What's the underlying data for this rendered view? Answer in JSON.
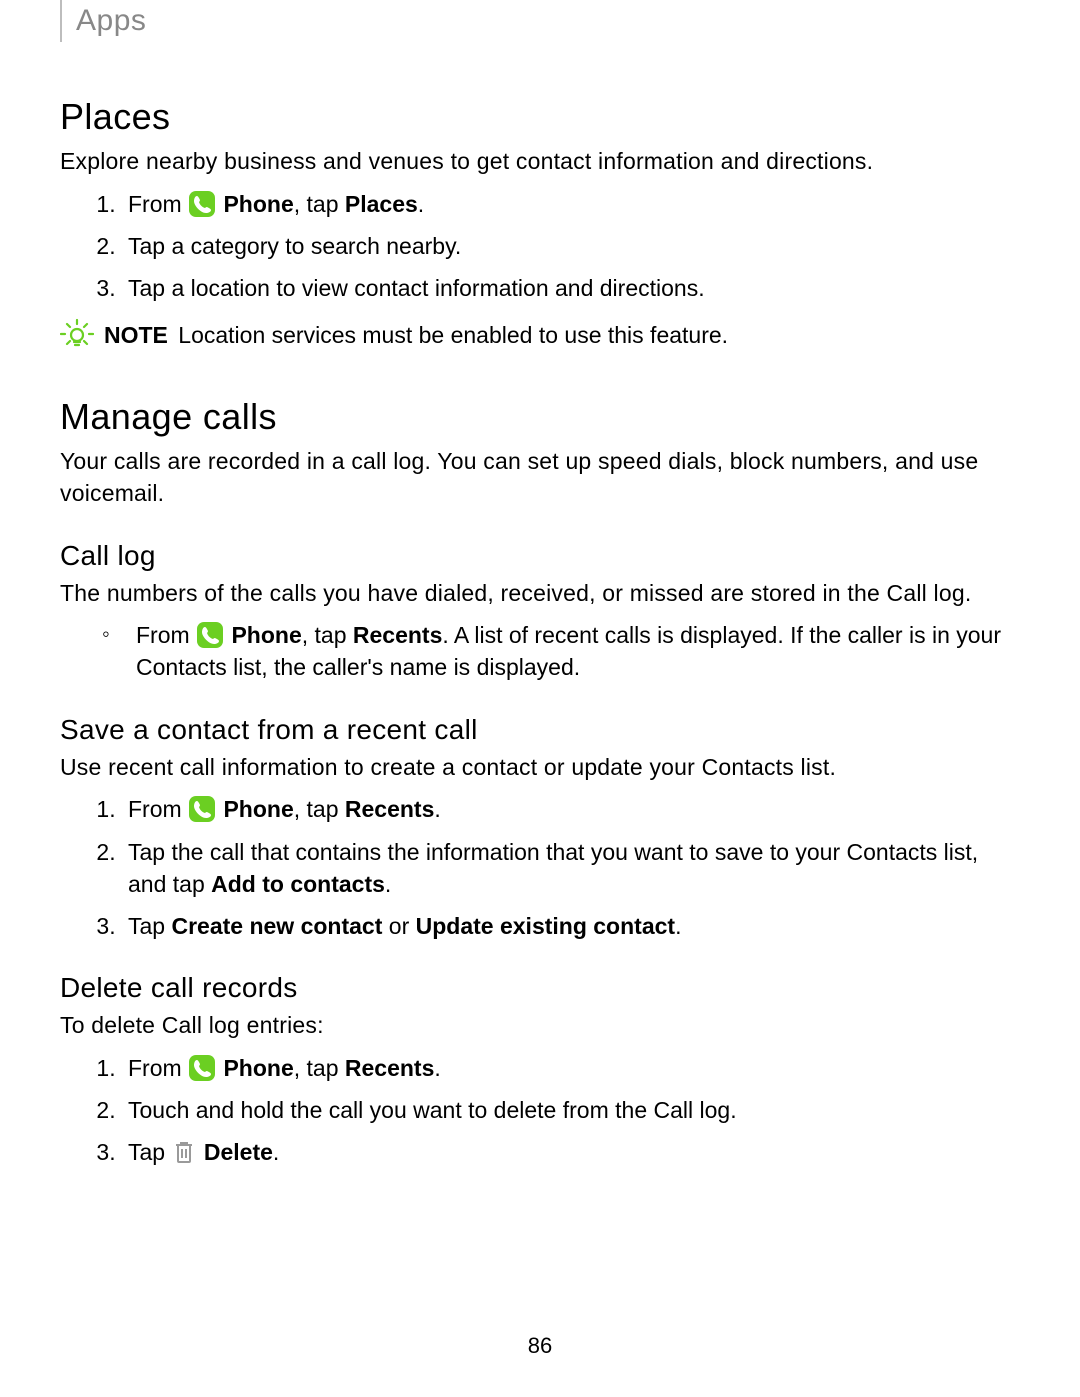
{
  "breadcrumb": "Apps",
  "page_number": "86",
  "places": {
    "heading": "Places",
    "intro": "Explore nearby business and venues to get contact information and directions.",
    "steps": {
      "s1_pre": "From ",
      "s1_phone": "Phone",
      "s1_mid": ", tap ",
      "s1_target": "Places",
      "s1_end": ".",
      "s2": "Tap a category to search nearby.",
      "s3": "Tap a location to view contact information and directions."
    },
    "note_label": "NOTE",
    "note_text": "Location services must be enabled to use this feature."
  },
  "manage": {
    "heading": "Manage calls",
    "intro": "Your calls are recorded in a call log. You can set up speed dials, block numbers, and use voicemail."
  },
  "calllog": {
    "heading": "Call log",
    "intro": "The numbers of the calls you have dialed, received, or missed are stored in the Call log.",
    "bullet_pre": "From ",
    "bullet_phone": "Phone",
    "bullet_mid": ", tap ",
    "bullet_target": "Recents",
    "bullet_after": ". A list of recent calls is displayed. If the caller is in your Contacts list, the caller's name is displayed."
  },
  "save": {
    "heading": "Save a contact from a recent call",
    "intro": "Use recent call information to create a contact or update your Contacts list.",
    "s1_pre": "From ",
    "s1_phone": "Phone",
    "s1_mid": ", tap ",
    "s1_target": "Recents",
    "s1_end": ".",
    "s2_pre": "Tap the call that contains the information that you want to save to your Contacts list, and tap ",
    "s2_bold": "Add to contacts",
    "s2_end": ".",
    "s3_pre": "Tap ",
    "s3_b1": "Create new contact",
    "s3_or": " or ",
    "s3_b2": "Update existing contact",
    "s3_end": "."
  },
  "delete": {
    "heading": "Delete call records",
    "intro": "To delete Call log entries:",
    "s1_pre": "From ",
    "s1_phone": "Phone",
    "s1_mid": ", tap ",
    "s1_target": "Recents",
    "s1_end": ".",
    "s2": "Touch and hold the call you want to delete from the Call log.",
    "s3_pre": "Tap ",
    "s3_bold": "Delete",
    "s3_end": "."
  }
}
